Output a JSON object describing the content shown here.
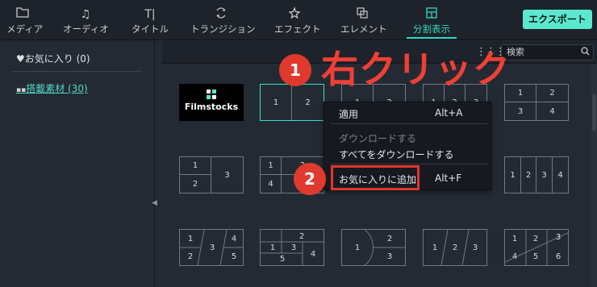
{
  "toolbar": {
    "tabs": [
      {
        "label": "メディア",
        "icon": "folder-icon"
      },
      {
        "label": "オーディオ",
        "icon": "music-note-icon"
      },
      {
        "label": "タイトル",
        "icon": "title-text-icon"
      },
      {
        "label": "トランジション",
        "icon": "transition-icon"
      },
      {
        "label": "エフェクト",
        "icon": "effect-star-icon"
      },
      {
        "label": "エレメント",
        "icon": "element-squares-icon"
      },
      {
        "label": "分割表示",
        "icon": "split-screen-icon"
      }
    ],
    "active_tab": "分割表示",
    "export_label": "エクスポート",
    "accent_color": "#2fd6c2"
  },
  "sidebar": {
    "favorites_label": "♥お気に入り (0)",
    "category_label": "搭載素材 (30)"
  },
  "content": {
    "search_placeholder": "検索",
    "filmstocks_label": "Filmstocks"
  },
  "thumbnails": {
    "t2": [
      "1",
      "2"
    ],
    "t3": [
      "1",
      "2"
    ],
    "t4": [
      "1",
      "2",
      "3"
    ],
    "t5": [
      "1",
      "2",
      "3",
      "4"
    ],
    "t6": [
      "1",
      "2",
      "3"
    ],
    "t7": [
      "1",
      "2",
      "4",
      "5"
    ],
    "t8": [
      "1",
      "2",
      "3",
      "4"
    ],
    "t9": [
      "1",
      "2",
      "3",
      "4",
      "5"
    ],
    "t10": [
      "1",
      "2",
      "3",
      "4",
      "5"
    ],
    "t11": [
      "1",
      "2",
      "3"
    ],
    "t12": [
      "1",
      "2",
      "3"
    ],
    "t13": [
      "1",
      "2",
      "3",
      "4",
      "5",
      "6"
    ]
  },
  "context_menu": {
    "apply": "適用",
    "apply_shortcut": "Alt+A",
    "download": "ダウンロードする",
    "download_all": "すべてをダウンロードする",
    "add_favorite": "お気に入りに追加",
    "add_favorite_shortcut": "Alt+F"
  },
  "annotations": {
    "step1": "1",
    "step1_text": "右クリック",
    "step2": "2",
    "highlight_color": "#e2342c"
  }
}
